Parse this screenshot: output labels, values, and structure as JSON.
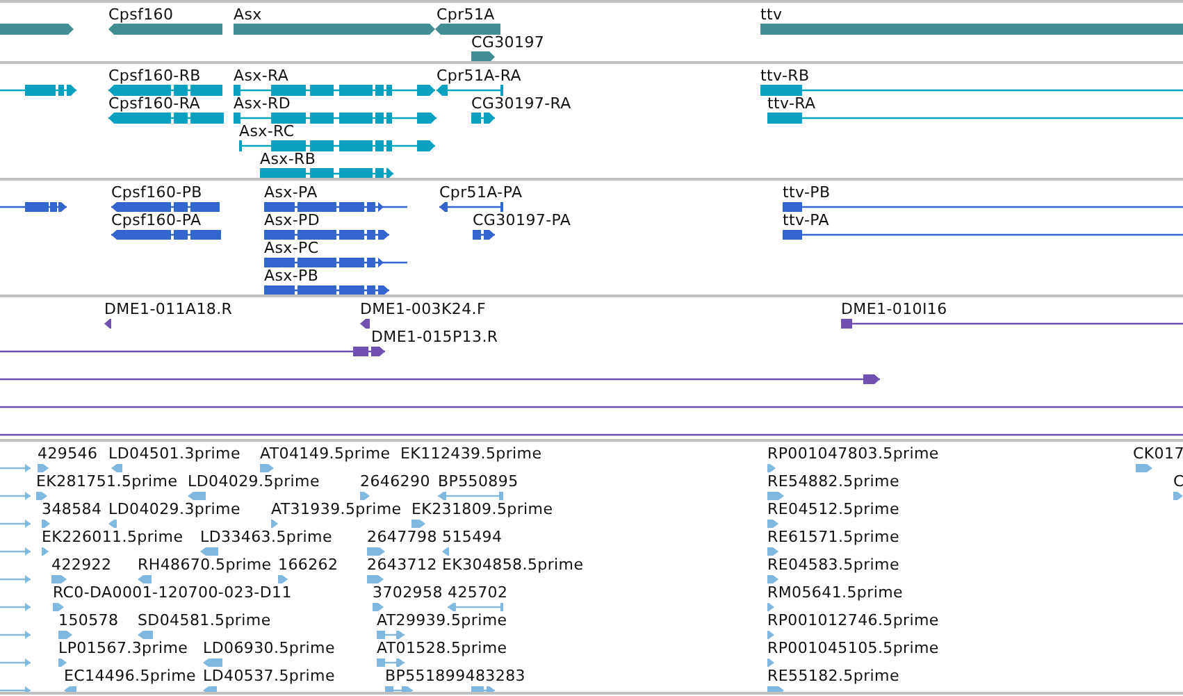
{
  "tracks": [
    {
      "kind": "genes",
      "color": "#418f93",
      "features": [
        {
          "reverse": false
        },
        {
          "label": "Cpsf160",
          "reverse": true
        },
        {
          "label": "Asx",
          "reverse": false
        },
        {
          "label": "Cpr51A",
          "reverse": true
        },
        {
          "label": "CG30197",
          "reverse": false
        },
        {
          "label": "ttv"
        }
      ]
    },
    {
      "kind": "transcripts",
      "color": "#0aa0c0",
      "features": [
        {
          "reverse": false
        },
        {
          "label": "Cpsf160-RB",
          "reverse": true
        },
        {
          "label": "Cpsf160-RA",
          "reverse": true
        },
        {
          "label": "Asx-RA",
          "reverse": false
        },
        {
          "label": "Cpr51A-RA",
          "reverse": true
        },
        {
          "label": "Asx-RD",
          "reverse": false
        },
        {
          "label": "CG30197-RA",
          "reverse": false
        },
        {
          "label": "Asx-RC",
          "reverse": false
        },
        {
          "label": "Asx-RB",
          "reverse": false
        },
        {
          "label": "ttv-RB"
        },
        {
          "label": "ttv-RA"
        }
      ]
    },
    {
      "kind": "proteins",
      "color": "#3366cc",
      "features": [
        {
          "reverse": false
        },
        {
          "label": "Cpsf160-PB",
          "reverse": true
        },
        {
          "label": "Cpsf160-PA",
          "reverse": true
        },
        {
          "label": "Asx-PA",
          "reverse": false
        },
        {
          "label": "Cpr51A-PA",
          "reverse": true
        },
        {
          "label": "Asx-PD",
          "reverse": false
        },
        {
          "label": "CG30197-PA",
          "reverse": false
        },
        {
          "label": "Asx-PC",
          "reverse": false
        },
        {
          "label": "Asx-PB",
          "reverse": false
        },
        {
          "label": "ttv-PB"
        },
        {
          "label": "ttv-PA"
        }
      ]
    },
    {
      "kind": "clones",
      "color": "#7050b0",
      "features": [
        {
          "kind": "clone",
          "label": "DME1-011A18.R",
          "reverse": true
        },
        {
          "kind": "clone",
          "label": "DME1-003K24.F",
          "reverse": true
        },
        {
          "kind": "clone",
          "label": "DME1-010I16"
        },
        {
          "kind": "clone",
          "label": "DME1-015P13.R",
          "reverse": false
        },
        {
          "kind": "clone",
          "reverse": false
        },
        {
          "kind": "line"
        },
        {
          "kind": "line"
        }
      ]
    },
    {
      "kind": "ests",
      "color": "#80b8e0",
      "features": [
        {
          "reverse": false
        },
        {
          "label": "429546",
          "reverse": false
        },
        {
          "label": "LD04501.3prime",
          "reverse": true
        },
        {
          "label": "AT04149.5prime",
          "reverse": false
        },
        {
          "label": "EK112439.5prime"
        },
        {
          "label": "RP001047803.5prime",
          "reverse": false
        },
        {
          "label": "CK017",
          "reverse": false
        },
        {
          "reverse": false
        },
        {
          "label": "EK281751.5prime",
          "reverse": false
        },
        {
          "label": "LD04029.5prime",
          "reverse": true
        },
        {
          "label": "2646290",
          "reverse": false
        },
        {
          "label": "BP550895",
          "reverse": true
        },
        {
          "label": "RE54882.5prime",
          "reverse": false
        },
        {
          "label": "C",
          "reverse": false
        },
        {
          "reverse": false
        },
        {
          "label": "348584",
          "reverse": false
        },
        {
          "label": "LD04029.3prime",
          "reverse": true
        },
        {
          "label": "AT31939.5prime",
          "reverse": false
        },
        {
          "label": "EK231809.5prime",
          "reverse": false
        },
        {
          "label": "RE04512.5prime",
          "reverse": false
        },
        {
          "reverse": false
        },
        {
          "label": "EK226011.5prime",
          "reverse": false
        },
        {
          "label": "LD33463.5prime",
          "reverse": true
        },
        {
          "label": "2647798",
          "reverse": false
        },
        {
          "label": "515494",
          "reverse": true
        },
        {
          "label": "RE61571.5prime",
          "reverse": false
        },
        {
          "reverse": false
        },
        {
          "label": "422922",
          "reverse": false
        },
        {
          "label": "RH48670.5prime",
          "reverse": true
        },
        {
          "label": "166262",
          "reverse": false
        },
        {
          "label": "2643712",
          "reverse": false
        },
        {
          "label": "EK304858.5prime"
        },
        {
          "label": "RE04583.5prime",
          "reverse": false
        },
        {
          "reverse": false
        },
        {
          "label": "RC0-DA0001-120700-023-D11",
          "reverse": false
        },
        {
          "label": "3702958",
          "reverse": false
        },
        {
          "label": "425702",
          "reverse": true
        },
        {
          "label": "RM05641.5prime",
          "reverse": false
        },
        {
          "reverse": false
        },
        {
          "label": "150578",
          "reverse": false
        },
        {
          "label": "SD04581.5prime",
          "reverse": true
        },
        {
          "label": "AT29939.5prime",
          "reverse": false
        },
        {
          "label": "RP001012746.5prime",
          "reverse": false
        },
        {
          "reverse": false
        },
        {
          "label": "LP01567.3prime",
          "reverse": false
        },
        {
          "label": "LD06930.5prime",
          "reverse": true
        },
        {
          "label": "AT01528.5prime",
          "reverse": false
        },
        {
          "label": "RP001045105.5prime",
          "reverse": false
        },
        {
          "reverse": false
        },
        {
          "label": "EC14496.5prime",
          "reverse": true
        },
        {
          "label": "LD40537.5prime",
          "reverse": true
        },
        {
          "label": "BP551899483283",
          "reverse": false
        },
        {
          "reverse": false
        },
        {
          "label": "RE55182.5prime",
          "reverse": false
        }
      ]
    }
  ]
}
